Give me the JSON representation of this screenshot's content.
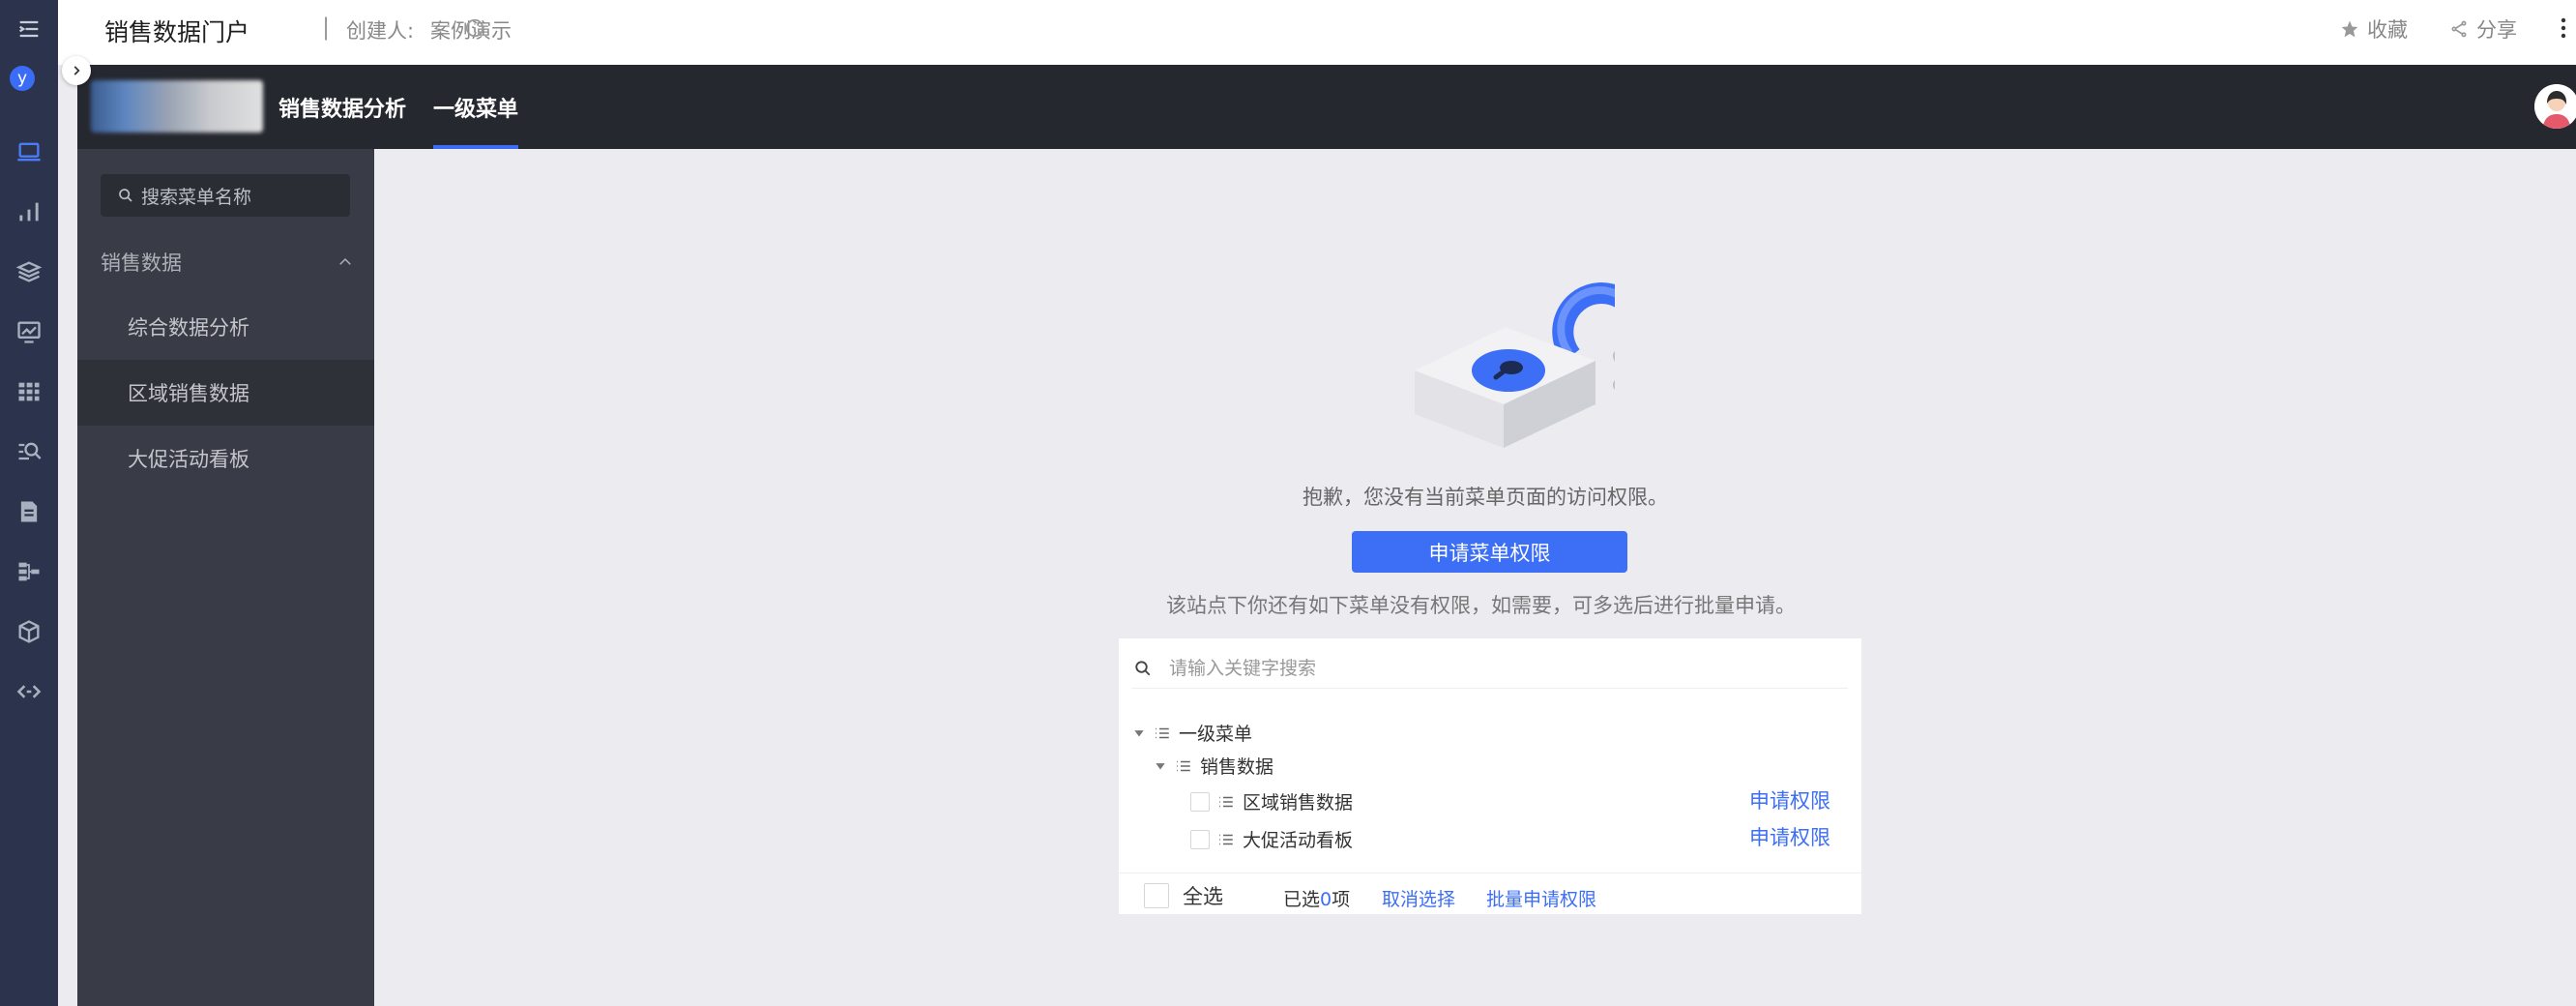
{
  "rail": {
    "user_initial": "y",
    "icons": [
      "computer-icon",
      "bar-chart-icon",
      "layers-icon",
      "monitor-chart-icon",
      "grid-icon",
      "search-people-icon",
      "document-icon",
      "flow-icon",
      "cube-icon",
      "code-icon"
    ]
  },
  "header": {
    "title": "销售数据门户",
    "separator": "|",
    "creator_label": "创建人:",
    "creator": "案例演示",
    "favorite_label": "收藏",
    "share_label": "分享"
  },
  "navbar": {
    "brand": "销售数据分析",
    "menu_level1": "一级菜单"
  },
  "sidemenu": {
    "search_placeholder": "搜索菜单名称",
    "group_label": "销售数据",
    "items": [
      {
        "label": "综合数据分析"
      },
      {
        "label": "区域销售数据",
        "active": true
      },
      {
        "label": "大促活动看板"
      }
    ]
  },
  "main": {
    "no_permission_msg": "抱歉，您没有当前菜单页面的访问权限。",
    "apply_button": "申请菜单权限",
    "hint": "该站点下你还有如下菜单没有权限，如需要，可多选后进行批量申请。",
    "keyword_placeholder": "请输入关键字搜索",
    "tree": {
      "root": "一级菜单",
      "group": "销售数据",
      "leaves": [
        {
          "label": "区域销售数据",
          "action": "申请权限"
        },
        {
          "label": "大促活动看板",
          "action": "申请权限"
        }
      ]
    },
    "footer": {
      "select_all": "全选",
      "selected_prefix": "已选",
      "selected_count": "0",
      "selected_suffix": "项",
      "cancel": "取消选择",
      "batch": "批量申请权限"
    }
  },
  "colors": {
    "accent": "#3c6ef6",
    "rail_bg": "#2b344c",
    "navbar_bg": "#262830",
    "sidemenu_bg": "#393c46"
  }
}
